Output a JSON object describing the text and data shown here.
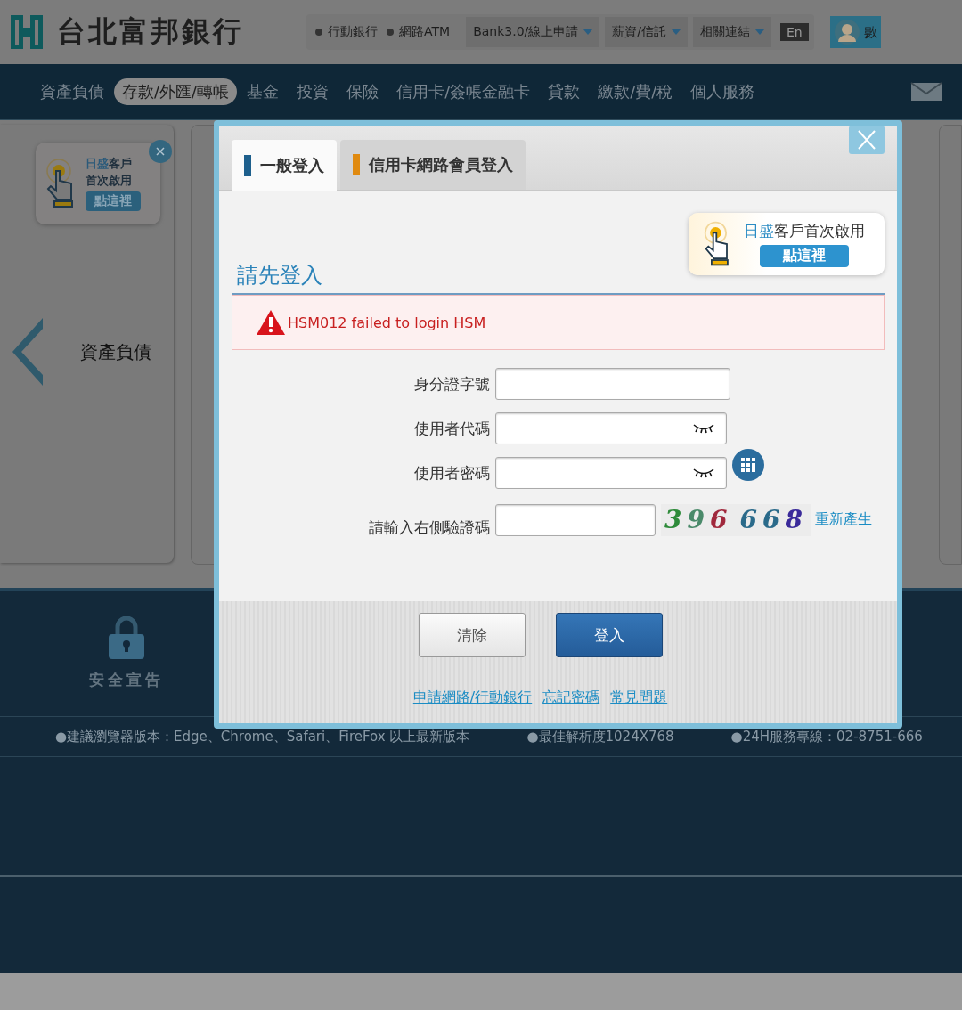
{
  "header": {
    "logo_text": "台北富邦銀行",
    "links": [
      {
        "label": "行動銀行"
      },
      {
        "label": "網路ATM"
      }
    ],
    "dropdowns": [
      {
        "label": "Bank3.0/線上申請"
      },
      {
        "label": "薪資/信託"
      },
      {
        "label": "相關連結"
      }
    ],
    "language": "En",
    "account_label": "數"
  },
  "nav": {
    "items": [
      {
        "label": "資產負債",
        "selected": false
      },
      {
        "label": "存款/外匯/轉帳",
        "selected": true
      },
      {
        "label": "基金",
        "selected": false
      },
      {
        "label": "投資",
        "selected": false
      },
      {
        "label": "保險",
        "selected": false
      },
      {
        "label": "信用卡/簽帳金融卡",
        "selected": false
      },
      {
        "label": "貸款",
        "selected": false
      },
      {
        "label": "繳款/費/稅",
        "selected": false
      },
      {
        "label": "個人服務",
        "selected": false
      }
    ]
  },
  "promo_card": {
    "highlight": "日盛",
    "line1_rest": "客戶",
    "line2": "首次啟用",
    "button": "點這裡"
  },
  "carousel": {
    "label": "資產負債"
  },
  "footer": {
    "items": [
      {
        "label": "安全宣告"
      }
    ],
    "notes": [
      "●建議瀏覽器版本：Edge、Chrome、Safari、FireFox 以上最新版本",
      "●最佳解析度1024X768",
      "●24H服務專線：02-8751-666"
    ]
  },
  "dialog": {
    "tabs": [
      {
        "label": "一般登入",
        "selected": true,
        "color": "#1d5f8c"
      },
      {
        "label": "信用卡網路會員登入",
        "selected": false,
        "color": "#e08a10"
      }
    ],
    "promo": {
      "highlight": "日盛",
      "rest": "客戶首次啟用",
      "button": "點這裡"
    },
    "heading": "請先登入",
    "error": "HSM012 failed to login HSM",
    "fields": [
      {
        "label": "身分證字號",
        "kind": "text"
      },
      {
        "label": "使用者代碼",
        "kind": "masked"
      },
      {
        "label": "使用者密碼",
        "kind": "password"
      },
      {
        "label": "請輸入右側驗證碼",
        "kind": "captcha"
      }
    ],
    "captcha": [
      {
        "char": "3",
        "color": "#2e8b3a"
      },
      {
        "char": "9",
        "color": "#4a8a6a"
      },
      {
        "char": "6",
        "color": "#a0283c"
      },
      {
        "char": "6",
        "color": "#2a6a8a"
      },
      {
        "char": "6",
        "color": "#2a6a8a"
      },
      {
        "char": "8",
        "color": "#3a2a9a"
      }
    ],
    "refresh_link": "重新產生",
    "buttons": [
      {
        "label": "清除",
        "kind": "secondary"
      },
      {
        "label": "登入",
        "kind": "primary"
      }
    ],
    "links": [
      "申請網路/行動銀行",
      "忘記密碼",
      "常見問題"
    ]
  }
}
